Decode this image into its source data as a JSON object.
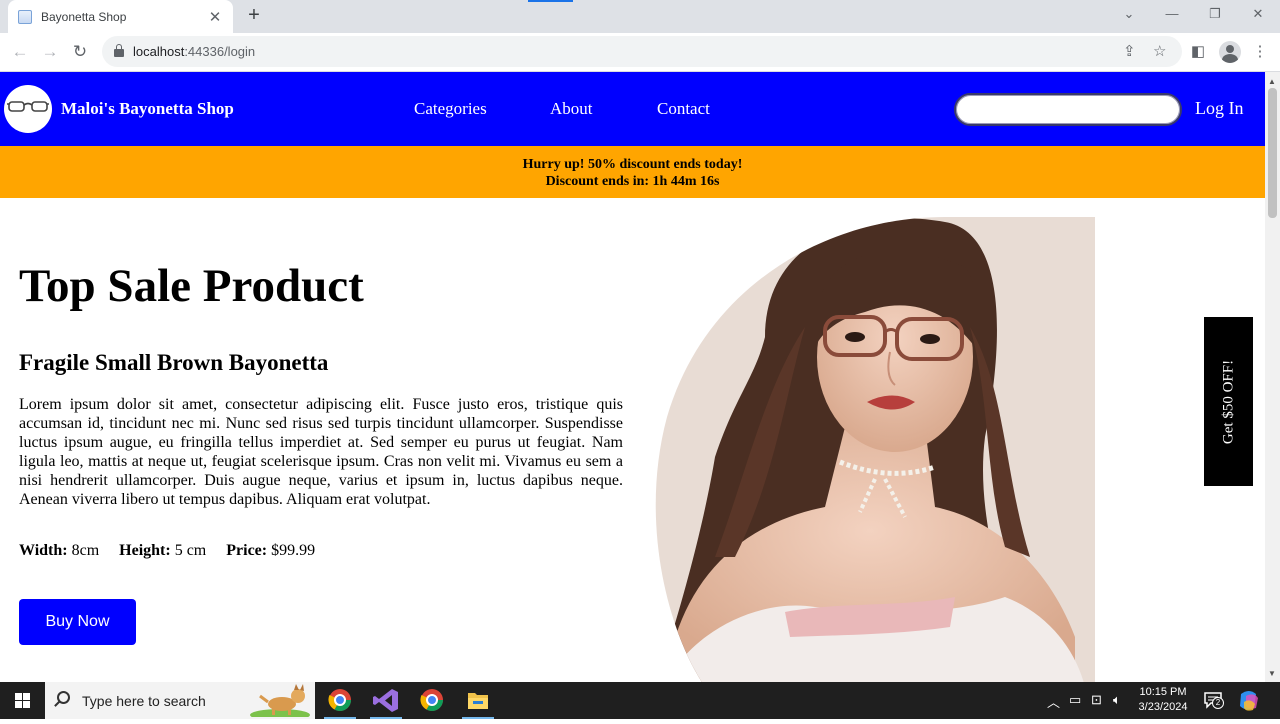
{
  "browser": {
    "tab_title": "Bayonetta Shop",
    "url_host": "localhost",
    "url_path": ":44336/login"
  },
  "header": {
    "brand": "Maloi's Bayonetta Shop",
    "nav": [
      "Categories",
      "About",
      "Contact"
    ],
    "search_value": "",
    "login_label": "Log In"
  },
  "promo": {
    "line1": "Hurry up! 50% discount ends today!",
    "line2": "Discount ends in: 1h 44m 16s"
  },
  "product": {
    "section_title": "Top Sale Product",
    "name": "Fragile Small Brown Bayonetta",
    "description": "Lorem ipsum dolor sit amet, consectetur adipiscing elit. Fusce justo eros, tristique quis accumsan id, tincidunt nec mi. Nunc sed risus sed turpis tincidunt ullamcorper. Suspendisse luctus ipsum augue, eu fringilla tellus imperdiet at. Sed semper eu purus ut feugiat. Nam ligula leo, mattis at neque ut, feugiat scelerisque ipsum. Cras non velit mi. Vivamus eu sem a nisi hendrerit ullamcorper. Duis augue neque, varius et ipsum in, luctus dapibus neque. Aenean viverra libero ut tempus dapibus. Aliquam erat volutpat.",
    "width_label": "Width:",
    "width_value": "8cm",
    "height_label": "Height:",
    "height_value": "5 cm",
    "price_label": "Price:",
    "price_value": "$99.99",
    "buy_label": "Buy Now"
  },
  "side_coupon": "Get $50 OFF!",
  "taskbar": {
    "search_placeholder": "Type here to search",
    "time": "10:15 PM",
    "date": "3/23/2024",
    "notification_count": "2"
  },
  "colors": {
    "header_bg": "#0000ff",
    "promo_bg": "#ffa500",
    "button_bg": "#0000ff",
    "coupon_bg": "#000000"
  }
}
